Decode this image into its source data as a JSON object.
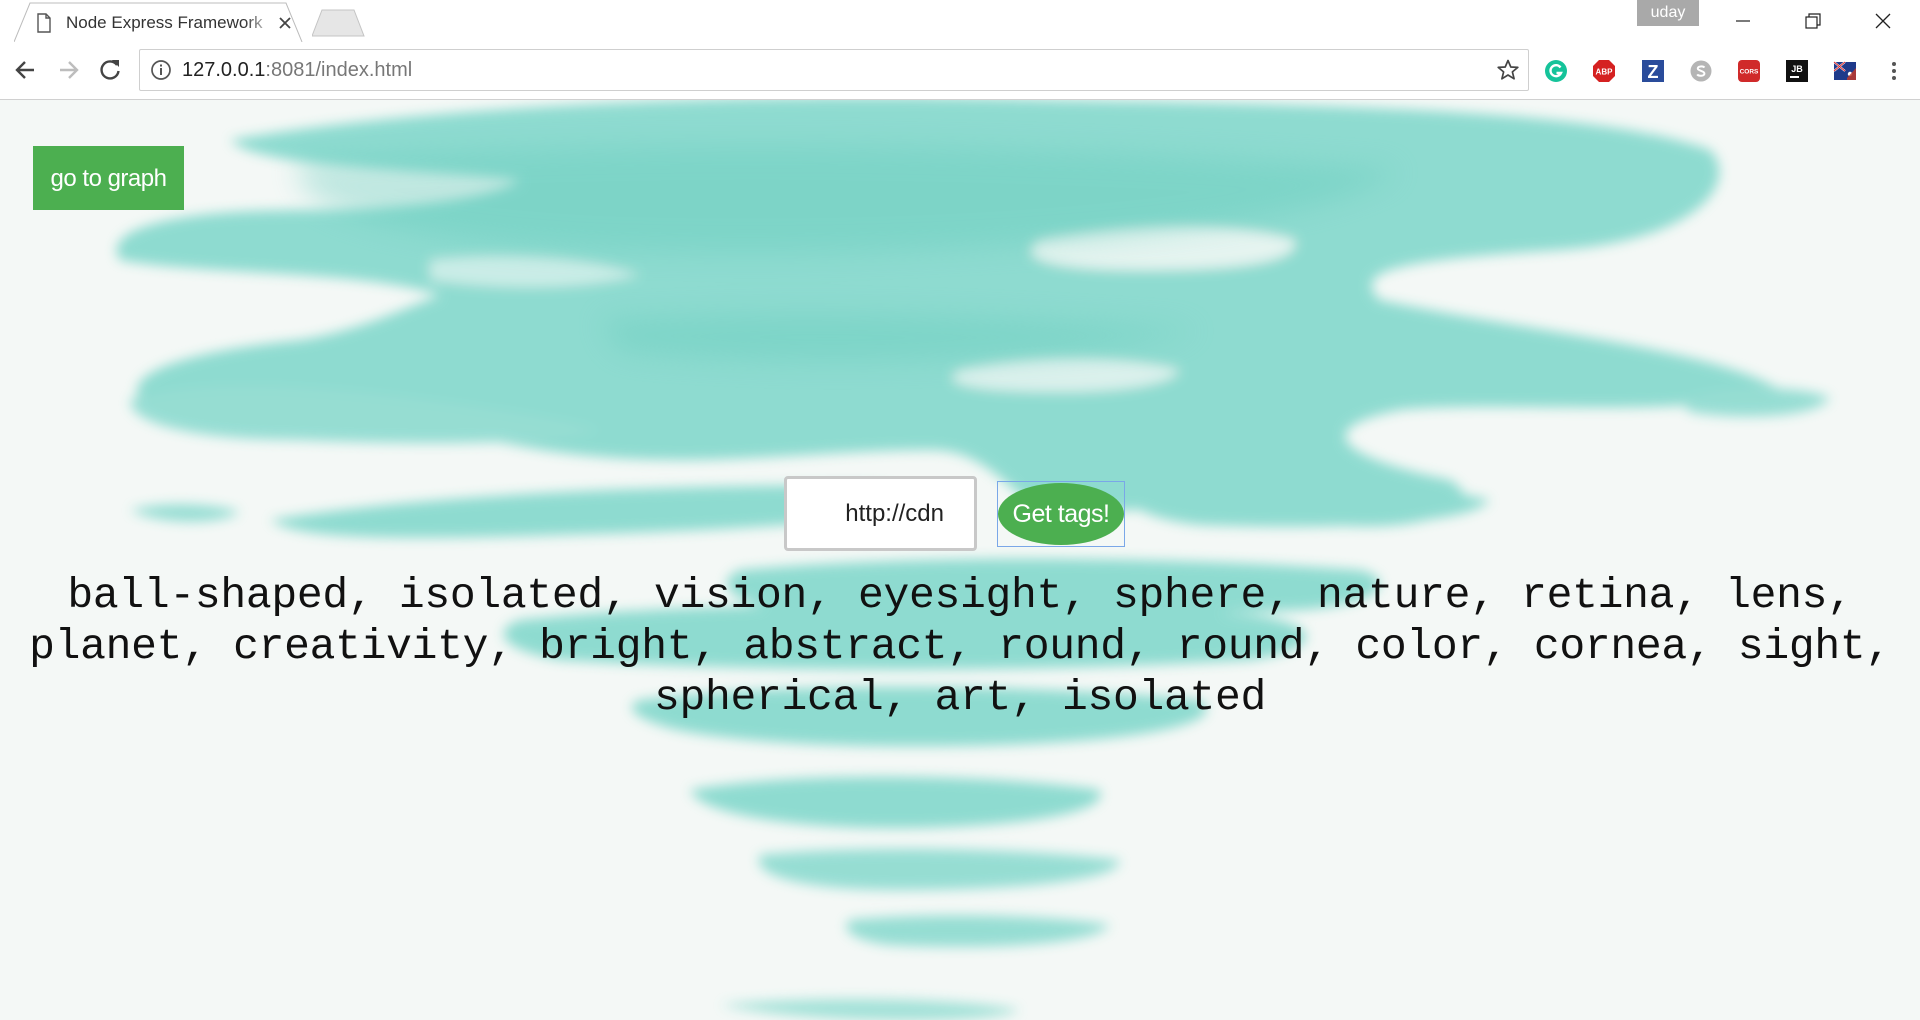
{
  "browser": {
    "tab": {
      "title": "Node Express Framework"
    },
    "profile": {
      "name": "uday"
    },
    "address": {
      "host": "127.0.0.1",
      "rest": ":8081/index.html"
    },
    "extensions": [
      "grammarly-icon",
      "adblock-plus-icon",
      "zotero-icon",
      "skype-icon",
      "cors-icon",
      "jetbrains-icon",
      "flag-icon",
      "menu-icon"
    ],
    "extension_labels": {
      "abp": "ABP",
      "z": "Z",
      "cors": "CORS",
      "jb": "JB"
    }
  },
  "page": {
    "graph_button": "go to graph",
    "url_input_value": "http://cdn",
    "get_tags_button": "Get tags!",
    "tags_text": "ball-shaped, isolated, vision, eyesight, sphere, nature, retina, lens, planet, creativity, bright, abstract, round, round, color, cornea, sight, spherical, art, isolated",
    "colors": {
      "accent_green": "#4caf50",
      "watercolor": "#7fd8cc"
    }
  }
}
